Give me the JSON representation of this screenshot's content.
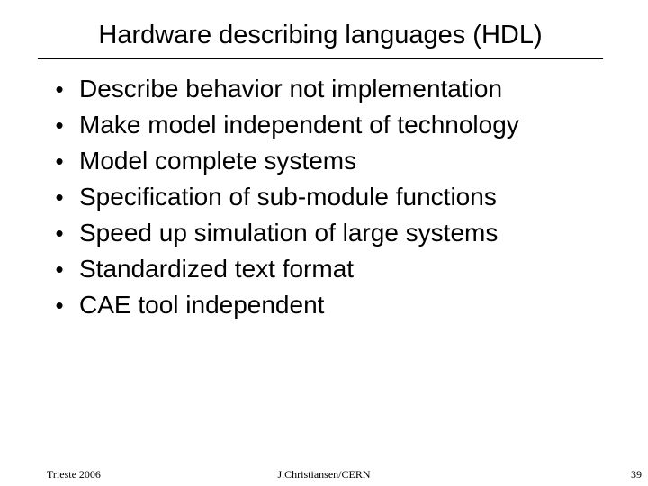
{
  "slide": {
    "title": "Hardware describing languages (HDL)",
    "bullet_glyph": "•",
    "bullets": [
      {
        "text": "Describe behavior not implementation"
      },
      {
        "text": "Make model independent of technology"
      },
      {
        "text": "Model complete systems"
      },
      {
        "text": "Specification of sub-module functions"
      },
      {
        "text": "Speed up simulation of large systems"
      },
      {
        "text": "Standardized text format"
      },
      {
        "text": "CAE tool independent"
      }
    ]
  },
  "footer": {
    "left": "Trieste 2006",
    "center": "J.Christiansen/CERN",
    "page_number": "39"
  },
  "colors": {
    "text": "#000000",
    "background": "#ffffff",
    "rule": "#000000"
  }
}
